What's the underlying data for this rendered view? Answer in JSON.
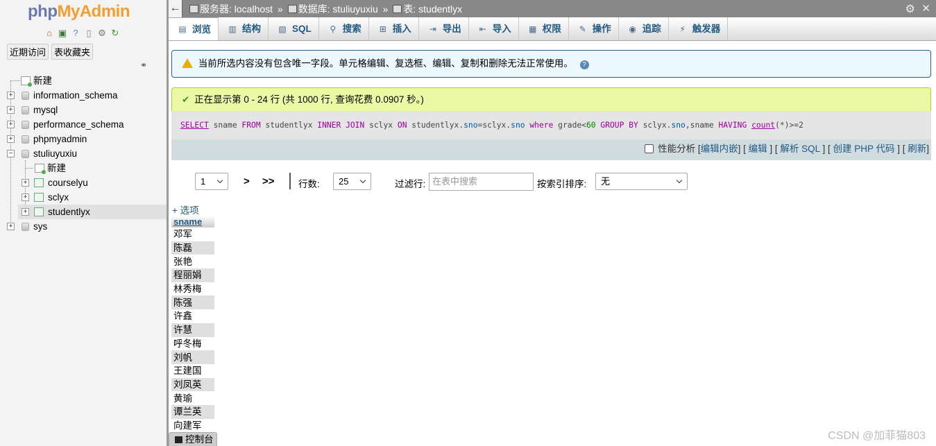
{
  "nav": {
    "logo_part1": "php",
    "logo_part2": "MyAdmin",
    "recent_tab": "近期访问",
    "favorites_tab": "表收藏夹",
    "tree": [
      {
        "label": "新建",
        "kind": "new"
      },
      {
        "label": "information_schema",
        "kind": "db"
      },
      {
        "label": "mysql",
        "kind": "db"
      },
      {
        "label": "performance_schema",
        "kind": "db"
      },
      {
        "label": "phpmyadmin",
        "kind": "db"
      },
      {
        "label": "stuliuyuxiu",
        "kind": "db",
        "expanded": true
      },
      {
        "label": "新建",
        "kind": "new-table"
      },
      {
        "label": "courselyu",
        "kind": "table"
      },
      {
        "label": "sclyx",
        "kind": "table"
      },
      {
        "label": "studentlyx",
        "kind": "table",
        "selected": true
      },
      {
        "label": "sys",
        "kind": "db"
      }
    ]
  },
  "breadcrumb": {
    "server": "服务器: localhost",
    "database": "数据库: stuliuyuxiu",
    "table": "表: studentlyx",
    "sep": "»"
  },
  "tabs": [
    {
      "label": "浏览",
      "icon": "browse-icon",
      "active": true
    },
    {
      "label": "结构",
      "icon": "structure-icon"
    },
    {
      "label": "SQL",
      "icon": "sql-icon"
    },
    {
      "label": "搜索",
      "icon": "search-icon"
    },
    {
      "label": "插入",
      "icon": "insert-icon"
    },
    {
      "label": "导出",
      "icon": "export-icon"
    },
    {
      "label": "导入",
      "icon": "import-icon"
    },
    {
      "label": "权限",
      "icon": "privileges-icon"
    },
    {
      "label": "操作",
      "icon": "operations-icon"
    },
    {
      "label": "追踪",
      "icon": "tracking-icon"
    },
    {
      "label": "触发器",
      "icon": "triggers-icon"
    }
  ],
  "notice": "当前所选内容没有包含唯一字段。单元格编辑、复选框、编辑、复制和删除无法正常使用。",
  "success": "正在显示第 0 - 24 行 (共 1000 行, 查询花费 0.0907 秒。)",
  "sql": "SELECT sname FROM studentlyx INNER JOIN sclyx ON studentlyx.sno=sclyx.sno where grade<60 GROUP BY sclyx.sno,sname HAVING count(*)>=2",
  "sql_links": {
    "profiling": "性能分析",
    "edit_inline": "编辑内嵌",
    "edit": "编辑",
    "explain": "解析 SQL",
    "create_php": "创建 PHP 代码",
    "refresh": "刷新"
  },
  "navbar": {
    "page": "1",
    "next": ">",
    "last": ">>",
    "rows_label": "行数:",
    "rows_value": "25",
    "filter_label": "过滤行:",
    "filter_placeholder": "在表中搜索",
    "sort_label": "按索引排序:",
    "sort_value": "无"
  },
  "options_link": "+ 选项",
  "results": {
    "column": "sname",
    "rows": [
      "邓军",
      "陈磊",
      "张艳",
      "程丽娟",
      "林秀梅",
      "陈强",
      "许鑫",
      "许慧",
      "呼冬梅",
      "刘帆",
      "王建国",
      "刘凤英",
      "黄瑜",
      "谭兰英",
      "向建军"
    ]
  },
  "console": "控制台",
  "watermark": "CSDN @加菲猫803"
}
